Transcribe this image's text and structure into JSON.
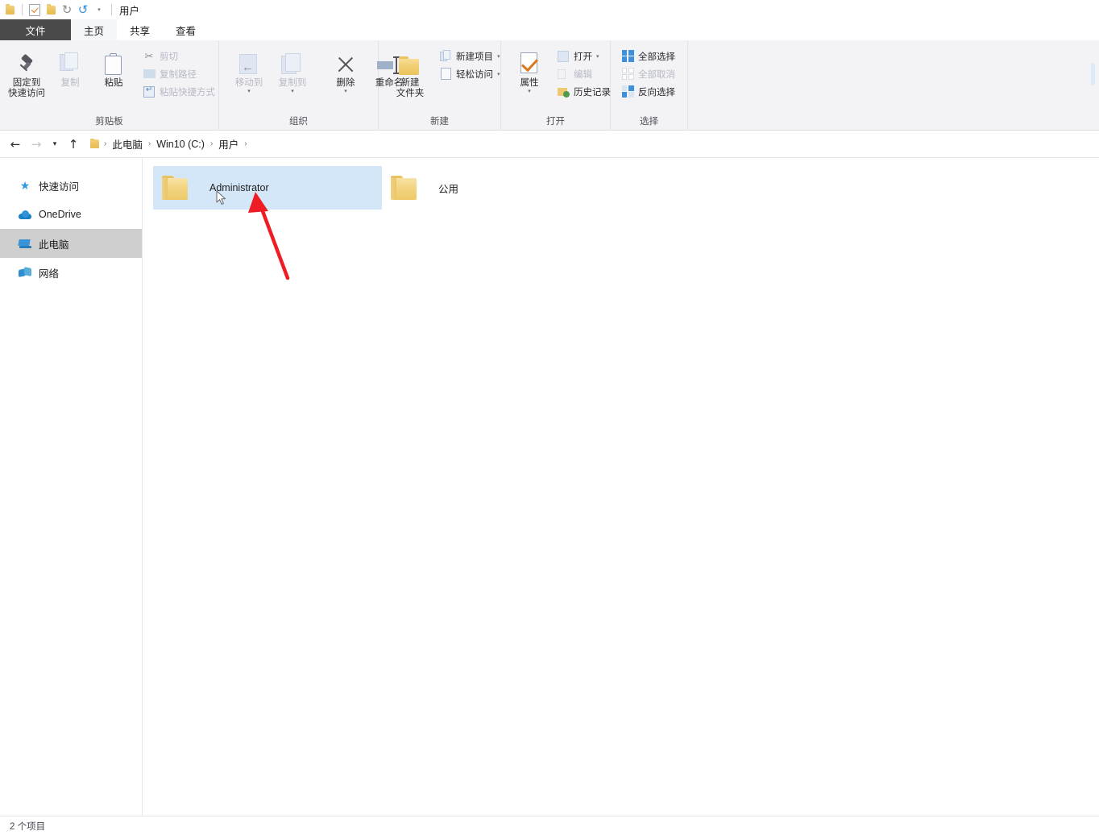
{
  "window": {
    "title": "用户",
    "quick_access": [
      {
        "name": "folder-icon",
        "label": "文件资源管理器"
      },
      {
        "name": "properties-icon",
        "label": "属性"
      },
      {
        "name": "new-folder-icon",
        "label": "新建文件夹"
      },
      {
        "name": "redo-icon",
        "label": "重做"
      },
      {
        "name": "undo-icon",
        "label": "撤消"
      },
      {
        "name": "customize-caret-icon",
        "label": "自定义快速访问工具栏"
      }
    ]
  },
  "tabs": [
    {
      "id": "file",
      "label": "文件",
      "active": false,
      "style": "file"
    },
    {
      "id": "home",
      "label": "主页",
      "active": true,
      "style": "normal"
    },
    {
      "id": "share",
      "label": "共享",
      "active": false,
      "style": "normal"
    },
    {
      "id": "view",
      "label": "查看",
      "active": false,
      "style": "normal"
    }
  ],
  "ribbon": {
    "groups": [
      {
        "id": "clipboard",
        "label": "剪贴板",
        "big": [
          {
            "id": "pin",
            "label": "固定到\n快速访问",
            "disabled": false
          },
          {
            "id": "copy",
            "label": "复制",
            "disabled": true
          },
          {
            "id": "paste",
            "label": "粘贴",
            "disabled": false
          }
        ],
        "small": [
          {
            "id": "cut",
            "label": "剪切",
            "disabled": true,
            "caret": false
          },
          {
            "id": "copy-path",
            "label": "复制路径",
            "disabled": true,
            "caret": false
          },
          {
            "id": "paste-shortcut",
            "label": "粘贴快捷方式",
            "disabled": true,
            "caret": false
          }
        ]
      },
      {
        "id": "organize",
        "label": "组织",
        "big": [
          {
            "id": "move-to",
            "label": "移动到",
            "disabled": true,
            "caret": true
          },
          {
            "id": "copy-to",
            "label": "复制到",
            "disabled": true,
            "caret": true
          },
          {
            "id": "delete",
            "label": "删除",
            "disabled": false,
            "caret": true
          },
          {
            "id": "rename",
            "label": "重命名",
            "disabled": false,
            "caret": false
          }
        ],
        "small": []
      },
      {
        "id": "new",
        "label": "新建",
        "big": [
          {
            "id": "new-folder",
            "label": "新建\n文件夹",
            "disabled": false
          }
        ],
        "small": [
          {
            "id": "new-item",
            "label": "新建项目",
            "disabled": false,
            "caret": true
          },
          {
            "id": "easy-access",
            "label": "轻松访问",
            "disabled": false,
            "caret": true
          }
        ]
      },
      {
        "id": "open",
        "label": "打开",
        "big": [
          {
            "id": "properties",
            "label": "属性",
            "disabled": false,
            "caret": true
          }
        ],
        "small": [
          {
            "id": "open",
            "label": "打开",
            "disabled": false,
            "caret": true
          },
          {
            "id": "edit",
            "label": "编辑",
            "disabled": true,
            "caret": false
          },
          {
            "id": "history",
            "label": "历史记录",
            "disabled": false,
            "caret": false
          }
        ]
      },
      {
        "id": "select",
        "label": "选择",
        "big": [],
        "small": [
          {
            "id": "select-all",
            "label": "全部选择",
            "disabled": false,
            "caret": false
          },
          {
            "id": "select-none",
            "label": "全部取消",
            "disabled": true,
            "caret": false
          },
          {
            "id": "invert",
            "label": "反向选择",
            "disabled": false,
            "caret": false
          }
        ]
      }
    ]
  },
  "address_bar": {
    "back_label": "后退",
    "forward_label": "前进",
    "recent_label": "最近浏览的位置",
    "up_label": "上移一级",
    "breadcrumbs": [
      "此电脑",
      "Win10 (C:)",
      "用户"
    ],
    "separator": "›"
  },
  "sidebar": {
    "items": [
      {
        "id": "quick-access",
        "label": "快速访问",
        "icon": "star-icon",
        "selected": false
      },
      {
        "id": "onedrive",
        "label": "OneDrive",
        "icon": "cloud-icon",
        "selected": false
      },
      {
        "id": "this-pc",
        "label": "此电脑",
        "icon": "computer-icon",
        "selected": true
      },
      {
        "id": "network",
        "label": "网络",
        "icon": "network-icon",
        "selected": false
      }
    ]
  },
  "content": {
    "items": [
      {
        "id": "administrator",
        "name": "Administrator",
        "type": "folder",
        "selected": true
      },
      {
        "id": "public",
        "name": "公用",
        "type": "folder",
        "selected": false
      }
    ]
  },
  "annotation": {
    "arrow_color": "#ee1c25",
    "points_to": "Administrator"
  },
  "status_bar": {
    "item_count_text": "2 个项目"
  },
  "colors": {
    "selection_blue": "#d4e7f8",
    "sidebar_selected": "#cfcfcf",
    "ribbon_bg": "#f3f3f6",
    "file_tab_bg": "#4a4a4a",
    "folder_yellow": "#f3d584"
  }
}
